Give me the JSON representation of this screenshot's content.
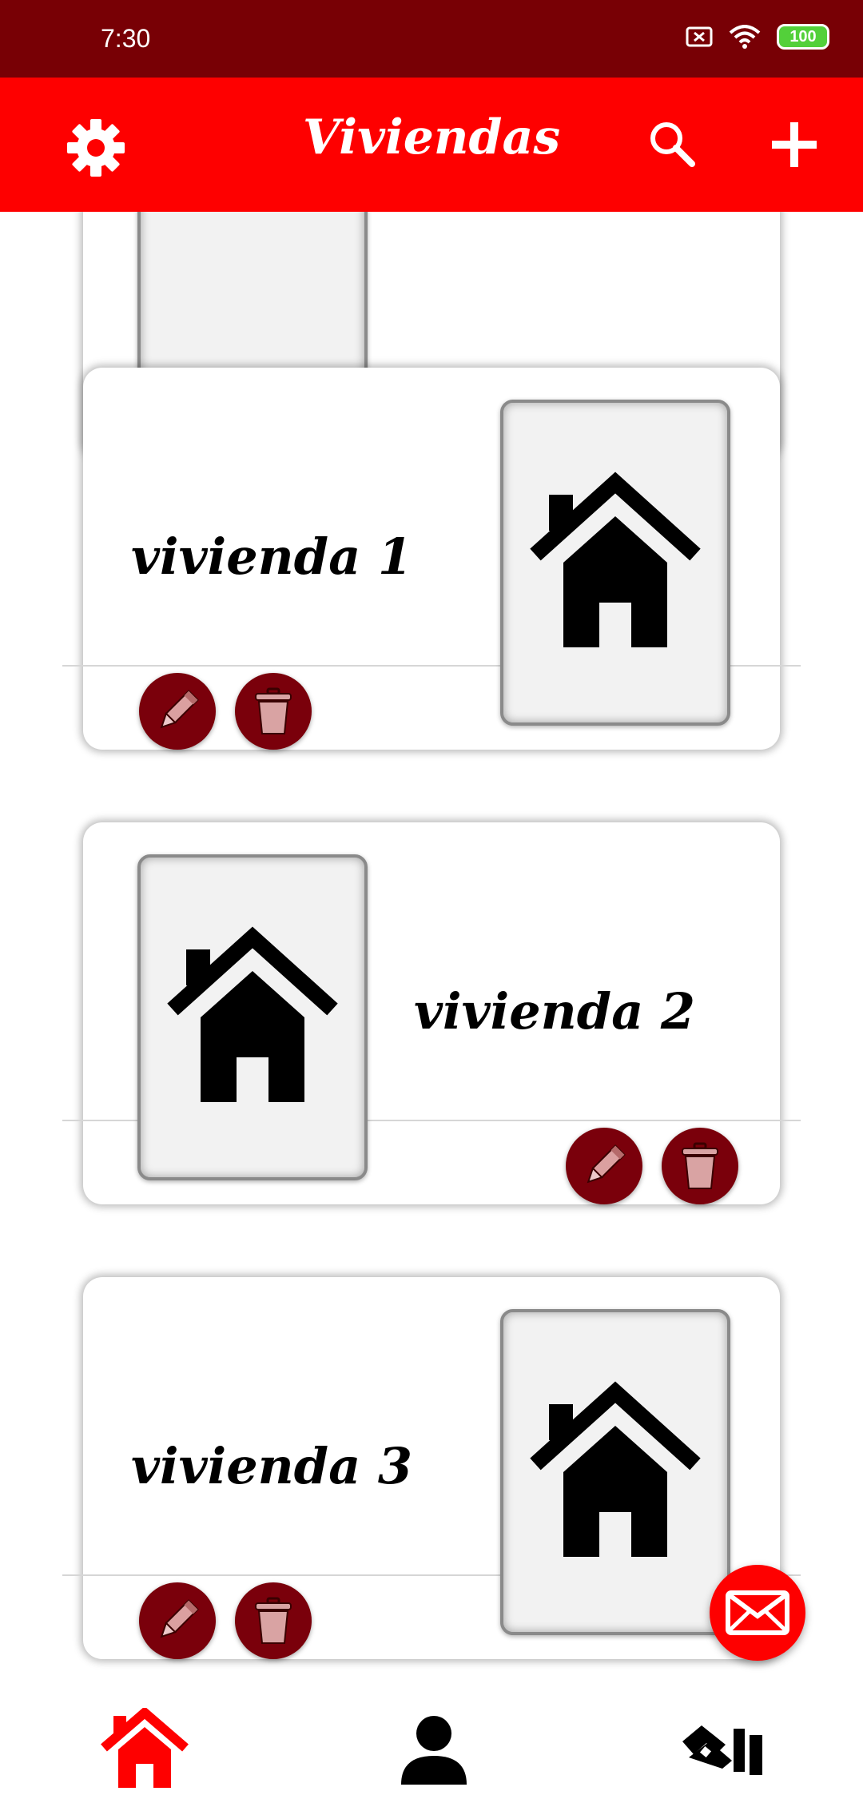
{
  "status_bar": {
    "time": "7:30",
    "battery": "100"
  },
  "app_bar": {
    "title": "Viviendas",
    "settings_icon": "gear-icon",
    "search_icon": "search-icon",
    "add_icon": "plus-icon"
  },
  "cards": [
    {
      "title": ""
    },
    {
      "title": "vivienda 1"
    },
    {
      "title": "vivienda 2"
    },
    {
      "title": "vivienda 3"
    }
  ],
  "actions": {
    "edit_icon": "pencil-icon",
    "delete_icon": "trash-icon"
  },
  "fab": {
    "icon": "mail-icon"
  },
  "bottom_nav": [
    {
      "icon": "home-icon",
      "active": true,
      "color": "#fe0000"
    },
    {
      "icon": "person-icon",
      "active": false,
      "color": "#000000"
    },
    {
      "icon": "handshake-icon",
      "active": false,
      "color": "#000000"
    }
  ],
  "colors": {
    "primary": "#fe0000",
    "primary_dark": "#780005",
    "action_circle": "#7a000b"
  }
}
